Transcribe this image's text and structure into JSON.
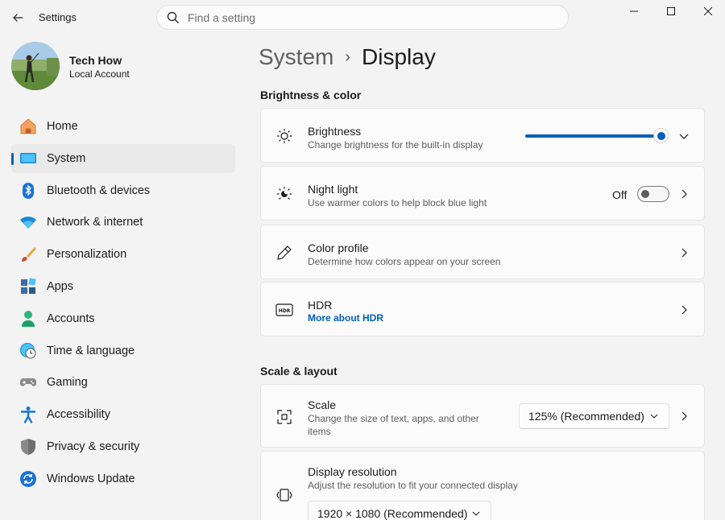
{
  "window": {
    "title": "Settings"
  },
  "search": {
    "placeholder": "Find a setting"
  },
  "profile": {
    "name": "Tech How",
    "account_type": "Local Account"
  },
  "nav": {
    "items": [
      {
        "label": "Home",
        "icon": "home-icon"
      },
      {
        "label": "System",
        "icon": "system-icon",
        "active": true
      },
      {
        "label": "Bluetooth & devices",
        "icon": "bluetooth-icon"
      },
      {
        "label": "Network & internet",
        "icon": "wifi-icon"
      },
      {
        "label": "Personalization",
        "icon": "brush-icon"
      },
      {
        "label": "Apps",
        "icon": "apps-icon"
      },
      {
        "label": "Accounts",
        "icon": "person-icon"
      },
      {
        "label": "Time & language",
        "icon": "clock-globe-icon"
      },
      {
        "label": "Gaming",
        "icon": "gamepad-icon"
      },
      {
        "label": "Accessibility",
        "icon": "accessibility-icon"
      },
      {
        "label": "Privacy & security",
        "icon": "shield-icon"
      },
      {
        "label": "Windows Update",
        "icon": "update-icon"
      }
    ]
  },
  "breadcrumb": {
    "parent": "System",
    "separator": "›",
    "current": "Display"
  },
  "sections": {
    "brightness_color": "Brightness & color",
    "scale_layout": "Scale & layout"
  },
  "brightness": {
    "title": "Brightness",
    "desc": "Change brightness for the built-in display",
    "level_percent": 100
  },
  "night_light": {
    "title": "Night light",
    "desc": "Use warmer colors to help block blue light",
    "state": "Off"
  },
  "color_profile": {
    "title": "Color profile",
    "desc": "Determine how colors appear on your screen"
  },
  "hdr": {
    "title": "HDR",
    "link": "More about HDR"
  },
  "scale": {
    "title": "Scale",
    "desc": "Change the size of text, apps, and other items",
    "value": "125% (Recommended)"
  },
  "resolution": {
    "title": "Display resolution",
    "desc": "Adjust the resolution to fit your connected display",
    "value": "1920 × 1080 (Recommended)"
  },
  "colors": {
    "accent": "#005fb8",
    "background": "#f3f3f3",
    "card": "#fbfbfb"
  }
}
